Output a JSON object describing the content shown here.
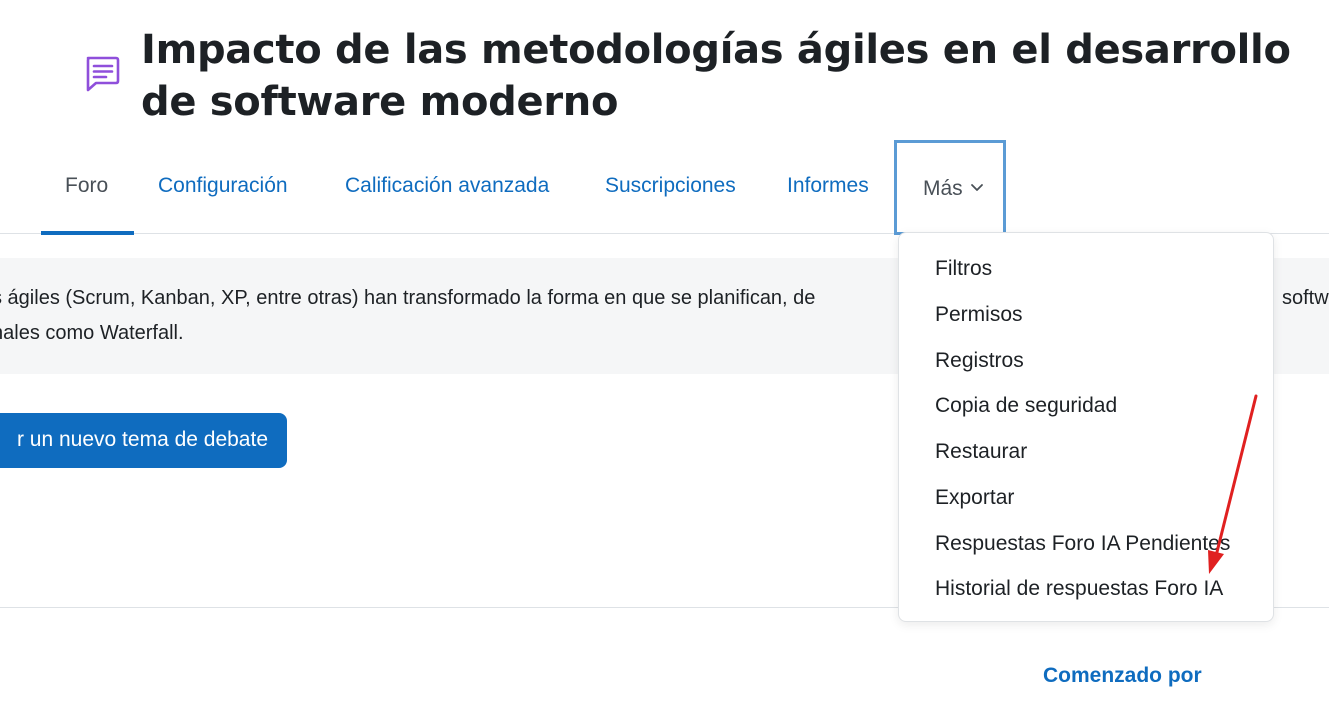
{
  "page": {
    "title": "Impacto de las metodologías ágiles en el desarrollo de software moderno",
    "icon": "forum-icon",
    "accent_color": "#0f6cbf"
  },
  "tabs": [
    {
      "label": "Foro",
      "active": true
    },
    {
      "label": "Configuración"
    },
    {
      "label": "Calificación avanzada"
    },
    {
      "label": "Suscripciones"
    },
    {
      "label": "Informes"
    },
    {
      "label": "Más",
      "icon": "chevron-down-icon"
    }
  ],
  "intro": {
    "line1": "s ágiles (Scrum, Kanban, XP, entre otras) han transformado la forma en que se planifican, de",
    "line1_right": "softw",
    "line2": "nales como Waterfall."
  },
  "add_button": {
    "label": "r un nuevo tema de debate"
  },
  "table": {
    "started_by_header": "Comenzado por"
  },
  "more_menu": {
    "items": [
      "Filtros",
      "Permisos",
      "Registros",
      "Copia de seguridad",
      "Restaurar",
      "Exportar",
      "Respuestas Foro IA Pendientes",
      "Historial de respuestas Foro IA"
    ]
  },
  "annotation": {
    "arrow_color": "#e02020"
  }
}
